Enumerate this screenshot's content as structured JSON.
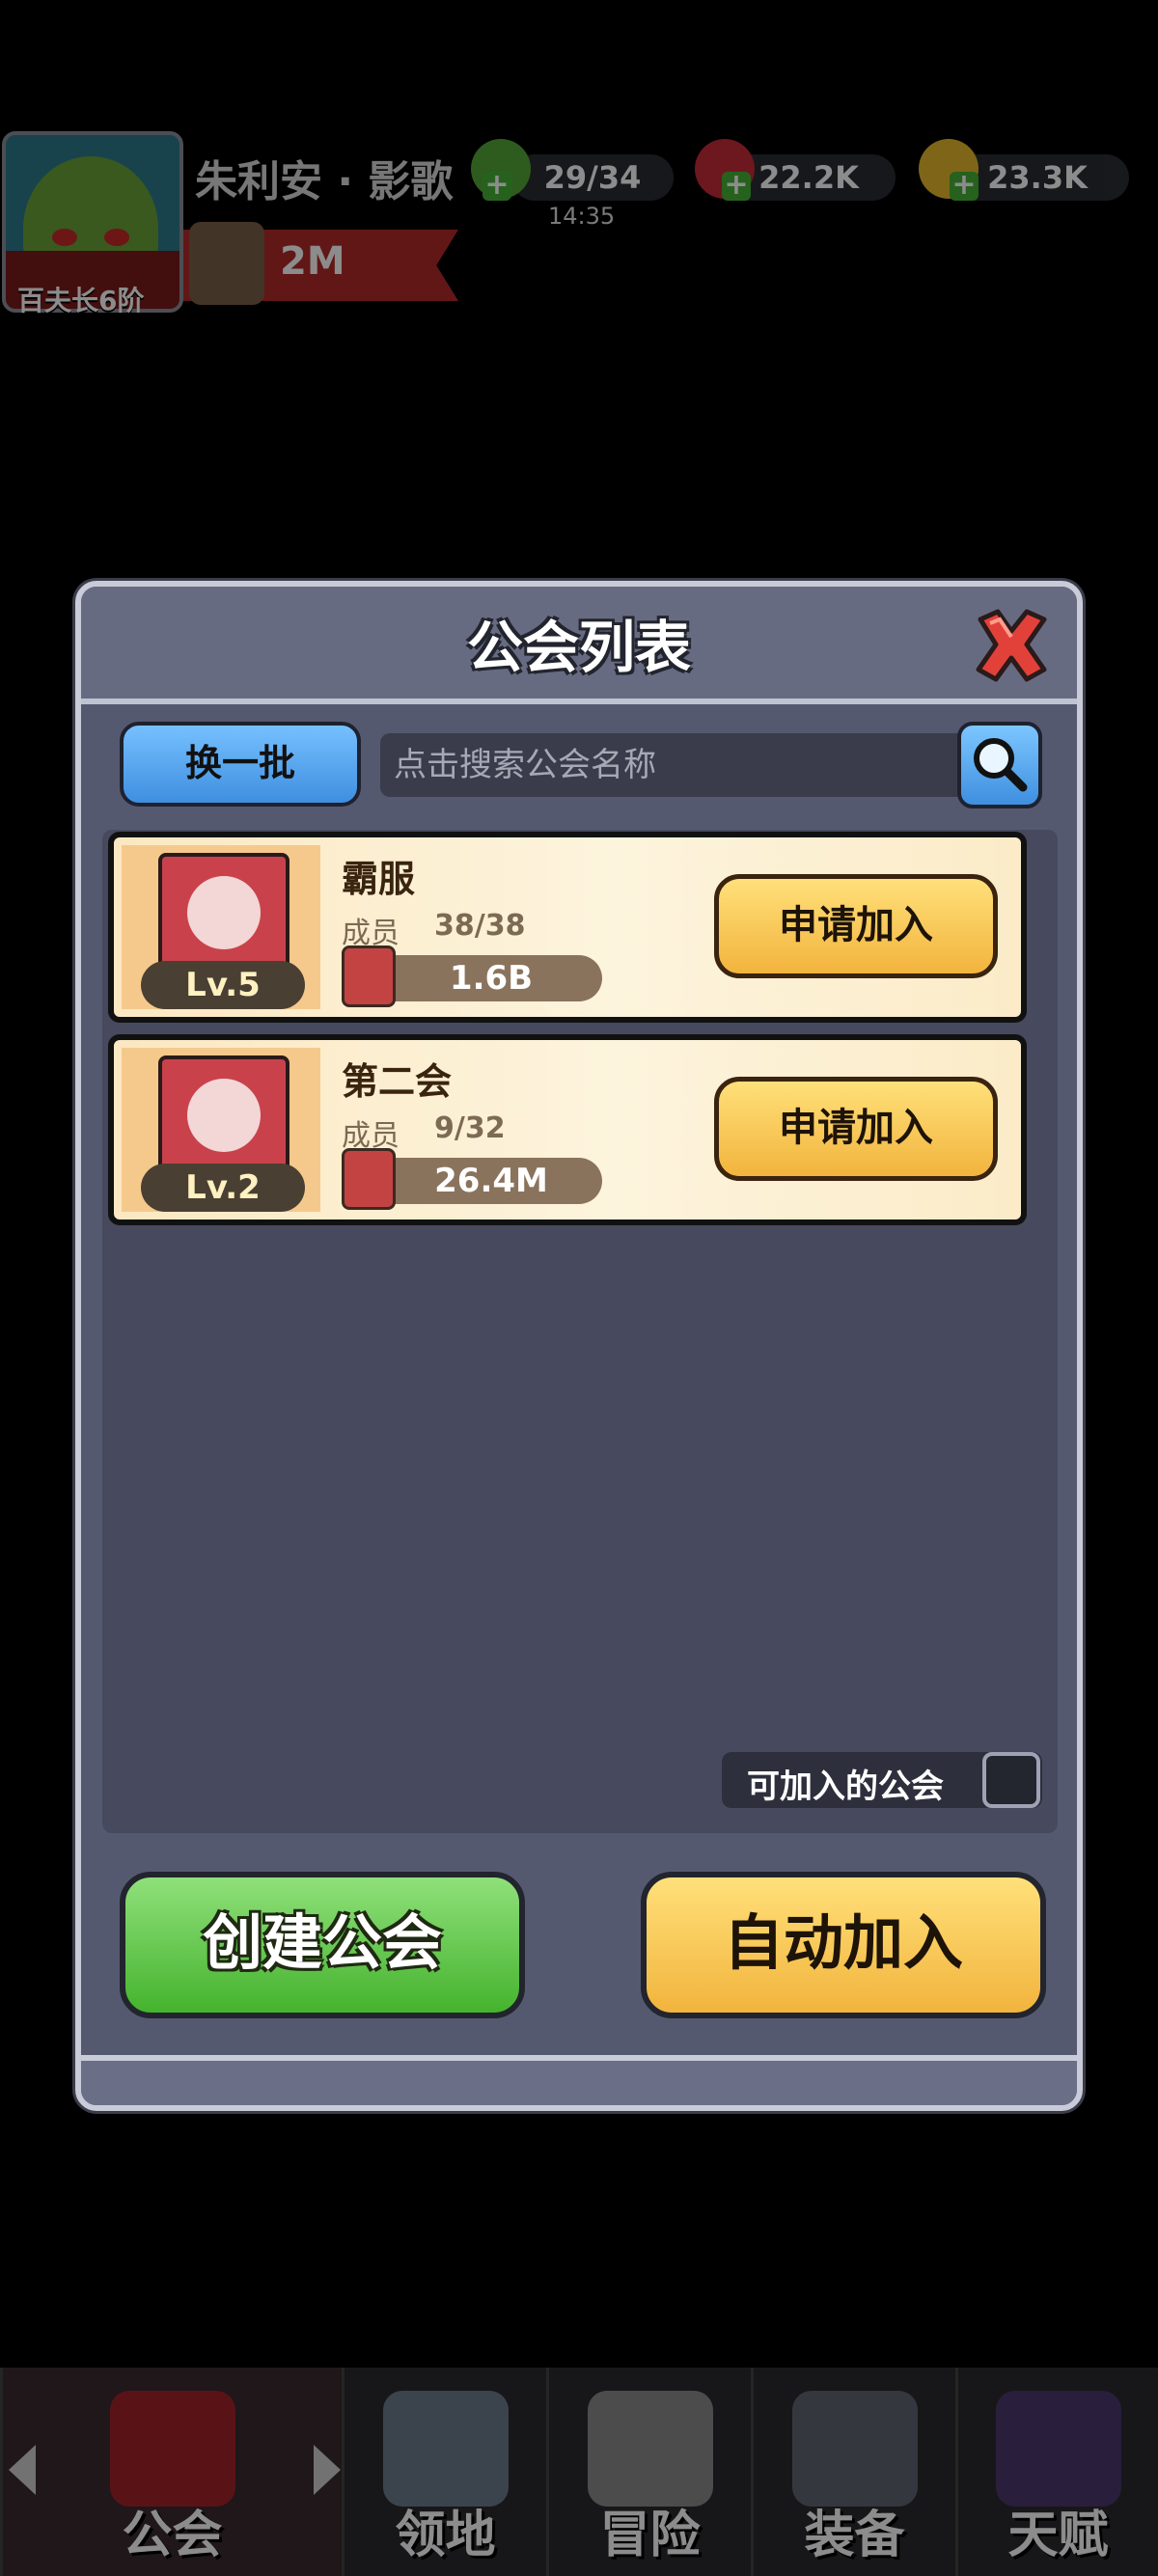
{
  "hud": {
    "player_name": "朱利安 · 影歌",
    "rank": "百夫长6阶",
    "stamina": "29/34",
    "stamina_timer": "14:35",
    "gems": "22.2K",
    "gold": "23.3K",
    "power": "2M"
  },
  "dialog": {
    "title": "公会列表",
    "refresh_label": "换一批",
    "search_placeholder": "点击搜索公会名称",
    "guilds": [
      {
        "name": "霸服",
        "member_label": "成员",
        "members": "38/38",
        "level": "Lv.5",
        "power": "1.6B",
        "apply_label": "申请加入"
      },
      {
        "name": "第二会",
        "member_label": "成员",
        "members": "9/32",
        "level": "Lv.2",
        "power": "26.4M",
        "apply_label": "申请加入"
      }
    ],
    "joinable_label": "可加入的公会",
    "create_label": "创建公会",
    "auto_join_label": "自动加入"
  },
  "nav": {
    "tabs": [
      {
        "label": "公会",
        "icon": "guild-banner-icon"
      },
      {
        "label": "领地",
        "icon": "castle-icon"
      },
      {
        "label": "冒险",
        "icon": "crossed-axes-icon"
      },
      {
        "label": "装备",
        "icon": "helmet-icon"
      },
      {
        "label": "天赋",
        "icon": "spellbook-icon"
      }
    ]
  },
  "colors": {
    "panel": "#555970",
    "apply_button": "#f2b43d",
    "create_button": "#45b32e",
    "refresh_button": "#3f8fe0"
  }
}
